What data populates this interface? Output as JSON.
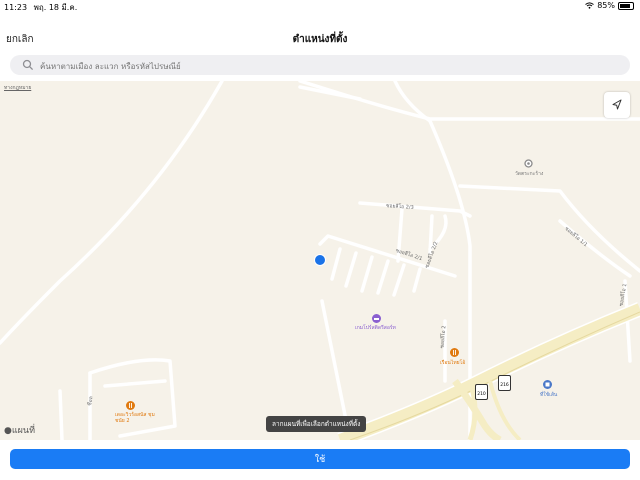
{
  "status": {
    "time": "11:23",
    "date": "พฤ. 18 มี.ค.",
    "battery": "85%",
    "battery_level": 0.85
  },
  "nav": {
    "cancel_label": "ยกเลิก",
    "title": "ตำแหน่งที่ตั้ง"
  },
  "search": {
    "placeholder": "ค้นหาตามเมือง ละแวก หรือรหัสไปรษณีย์"
  },
  "map": {
    "legal_label": "ทางกฎหมาย",
    "logo_text": "แผนที่",
    "tooltip": "ลากแผนที่เพื่อเลือกตำแหน่งที่ตั้ง",
    "streets": [
      "ซอยลีโอ 2/3",
      "ซอยลีโอ 2/1",
      "ซอยลีโอ 2/2",
      "ซอยลีโอ 2",
      "ซอยลีโอ 1/1",
      "ซอยลีโอ 1"
    ],
    "pois": [
      {
        "name": "วัดตระกะร้าง",
        "color": "#8a8a8a"
      },
      {
        "name": "เกมโปร์สติดรีสอร์ท",
        "color": "#8a5fd0"
      },
      {
        "name": "เรือนไทยโอ้",
        "color": "#e07a10"
      },
      {
        "name": "เดอะวิวร้อสนัส ชุมชนัย 2",
        "color": "#e07a10"
      },
      {
        "name": "ที่ใช้เส้น",
        "color": "#4a78c8"
      }
    ],
    "route_shields": [
      "210",
      "216"
    ],
    "other_labels": [
      "ซีอล"
    ]
  },
  "actions": {
    "use_label": "ใช้"
  },
  "colors": {
    "accent": "#1a7cf5",
    "map_bg": "#f6f2e9",
    "highway": "#f5edc4"
  }
}
